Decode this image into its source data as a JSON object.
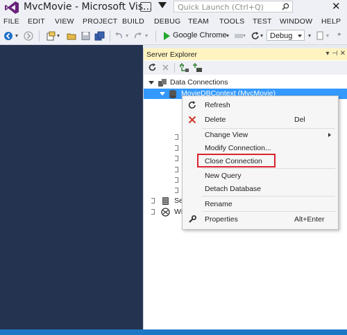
{
  "window": {
    "title": "MvcMovie - Microsoft Vis...",
    "quick_launch_placeholder": "Quick Launch (Ctrl+Q)",
    "close_glyph": "✕"
  },
  "menu": [
    "FILE",
    "EDIT",
    "VIEW",
    "PROJECT",
    "BUILD",
    "DEBUG",
    "TEAM",
    "TOOLS",
    "TEST",
    "WINDOW",
    "HELP"
  ],
  "toolbar": {
    "run_target": "Google Chrome",
    "configuration": "Debug"
  },
  "server_explorer": {
    "title": "Server Explorer",
    "header_icons": "▾ ⊣ ✕",
    "tree": {
      "data_connections": "Data Connections",
      "selected_connection": "MovieDBContext (MvcMovie)",
      "servers_partial": "Se",
      "web_partial": "Wi"
    }
  },
  "context_menu": {
    "items": [
      {
        "label": "Refresh",
        "shortcut": "",
        "icon": "refresh-icon"
      },
      {
        "label": "Delete",
        "shortcut": "Del",
        "icon": "delete-x-icon"
      },
      {
        "label": "Change View",
        "shortcut": "",
        "icon": "",
        "submenu": true
      },
      {
        "label": "Modify Connection...",
        "shortcut": "",
        "icon": ""
      },
      {
        "label": "Close Connection",
        "shortcut": "",
        "icon": "",
        "highlighted": true
      },
      {
        "label": "New Query",
        "shortcut": "",
        "icon": ""
      },
      {
        "label": "Detach Database",
        "shortcut": "",
        "icon": ""
      },
      {
        "label": "Rename",
        "shortcut": "",
        "icon": ""
      },
      {
        "label": "Properties",
        "shortcut": "Alt+Enter",
        "icon": "wrench-icon"
      }
    ]
  },
  "colors": {
    "accent_blue": "#3399ff",
    "highlight_red": "#d9232e",
    "editor_bg": "#243350",
    "status_bar": "#1c78c7"
  }
}
